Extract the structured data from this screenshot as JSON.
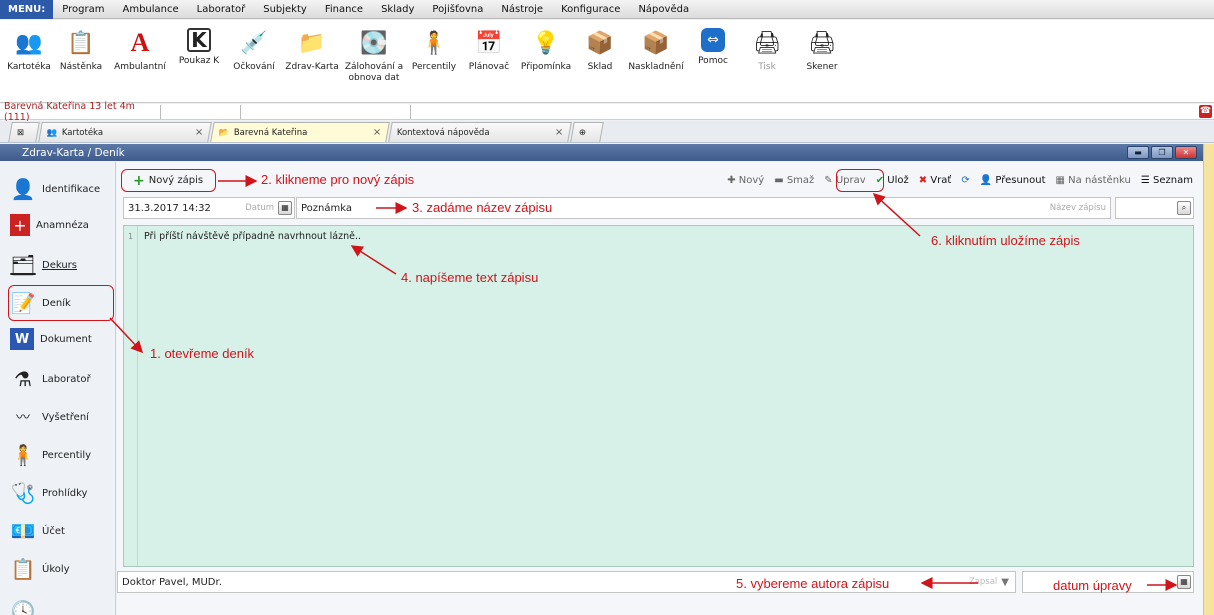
{
  "menu": {
    "label": "MENU:",
    "items": [
      "Program",
      "Ambulance",
      "Laboratoř",
      "Subjekty",
      "Finance",
      "Sklady",
      "Pojišťovna",
      "Nástroje",
      "Konfigurace",
      "Nápověda"
    ]
  },
  "toolbar": {
    "items": [
      {
        "label": "Kartotéka",
        "icon": "people-icon"
      },
      {
        "label": "Nástěnka",
        "icon": "board-icon"
      },
      {
        "label": "Ambulantní",
        "icon": "letter-a-icon"
      },
      {
        "label": "Poukaz K",
        "icon": "letter-k-icon"
      },
      {
        "label": "Očkování",
        "icon": "syringe-icon"
      },
      {
        "label": "Zdrav-Karta",
        "icon": "card-icon"
      },
      {
        "label": "Zálohování a obnova dat",
        "icon": "disk-icon"
      },
      {
        "label": "Percentily",
        "icon": "person-icon"
      },
      {
        "label": "Plánovač",
        "icon": "calendar-icon"
      },
      {
        "label": "Připomínka",
        "icon": "bulb-icon"
      },
      {
        "label": "Sklad",
        "icon": "box-icon"
      },
      {
        "label": "Naskladnění",
        "icon": "box-add-icon"
      },
      {
        "label": "Pomoc",
        "icon": "teamviewer-icon"
      },
      {
        "label": "Tisk",
        "icon": "printer-icon"
      },
      {
        "label": "Skener",
        "icon": "scanner-icon"
      }
    ]
  },
  "patient": {
    "name": "Barevná Kateřina 13 let 4m (111)"
  },
  "tabs": [
    {
      "label": "Kartotéka"
    },
    {
      "label": "Barevná Kateřina"
    },
    {
      "label": "Kontextová nápověda"
    }
  ],
  "window": {
    "title": "Zdrav-Karta / Deník"
  },
  "sidebar": {
    "items": [
      "Identifikace",
      "Anamnéza",
      "Dekurs",
      "Deník",
      "Dokument",
      "Laboratoř",
      "Vyšetření",
      "Percentily",
      "Prohlídky",
      "Účet",
      "Úkoly"
    ]
  },
  "actions": {
    "new_entry": "Nový zápis",
    "new": "Nový",
    "delete": "Smaž",
    "edit": "Uprav",
    "save": "Ulož",
    "revert": "Vrať",
    "move": "Přesunout",
    "to_board": "Na nástěnku",
    "list": "Seznam"
  },
  "form": {
    "date_value": "31.3.2017 14:32",
    "date_hint": "Datum",
    "title_value": "Poznámka",
    "title_hint": "Název zápisu",
    "text": "Při příští návštěvě případně navrhnout lázně..",
    "line_no": "1",
    "author_value": "Doktor Pavel, MUDr.",
    "author_hint": "Zapsal"
  },
  "annotations": {
    "a1": "1. otevřeme deník",
    "a2": "2. klikneme pro nový zápis",
    "a3": "3. zadáme název zápisu",
    "a4": "4. napíšeme text zápisu",
    "a5": "5. vybereme autora zápisu",
    "a6": "6. kliknutím uložíme zápis",
    "a7": "datum úpravy"
  },
  "colors": {
    "annotation": "#d0141a",
    "editor_bg": "#d7f1e8",
    "titlebar": "#4a6795"
  }
}
